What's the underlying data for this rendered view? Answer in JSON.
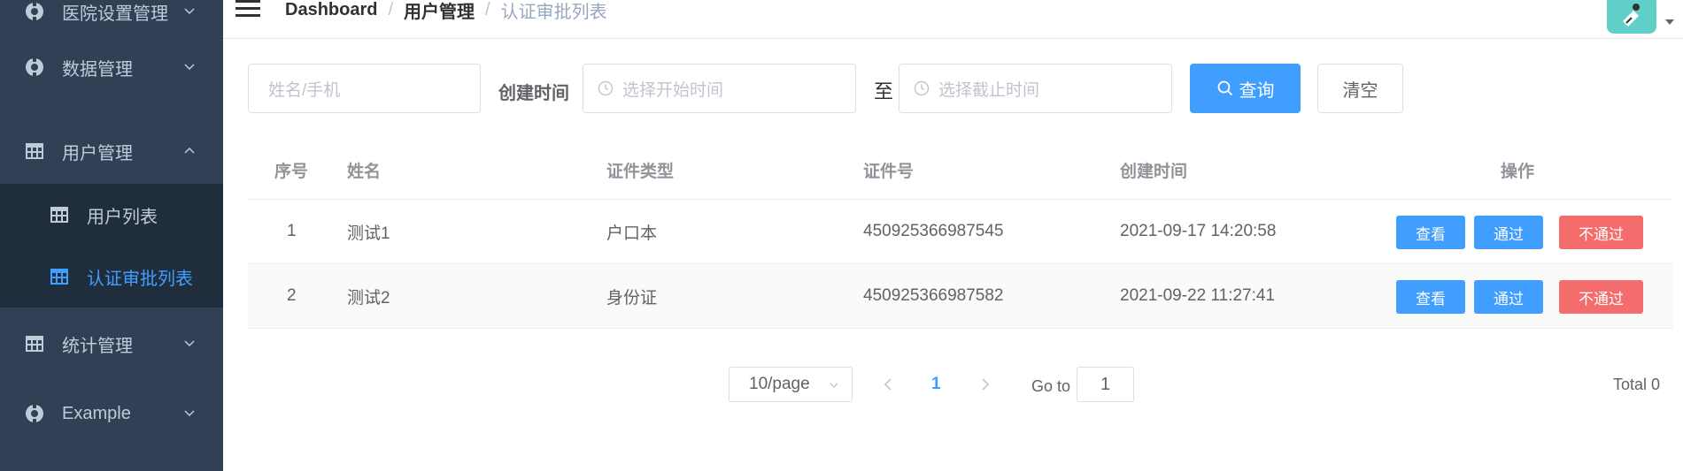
{
  "sidebar": {
    "items": [
      {
        "label": "医院设置管理",
        "icon": "gear-icon"
      },
      {
        "label": "数据管理",
        "icon": "gear-icon"
      },
      {
        "label": "用户管理",
        "icon": "table-icon",
        "expanded": true
      },
      {
        "label": "统计管理",
        "icon": "table-icon"
      },
      {
        "label": "Example",
        "icon": "gear-icon"
      }
    ],
    "subitems": [
      {
        "label": "用户列表",
        "icon": "table-icon"
      },
      {
        "label": "认证审批列表",
        "icon": "table-icon",
        "active": true
      }
    ],
    "colors": {
      "bg": "#304156",
      "sub_bg": "#1f2d3d",
      "text": "#bfcbd9",
      "active": "#409eff"
    }
  },
  "header": {
    "breadcrumb": [
      "Dashboard",
      "用户管理",
      "认证审批列表"
    ],
    "separator": "/"
  },
  "filters": {
    "keyword_placeholder": "姓名/手机",
    "created_label": "创建时间",
    "start_placeholder": "选择开始时间",
    "to_label": "至",
    "end_placeholder": "选择截止时间",
    "search_label": "查询",
    "clear_label": "清空"
  },
  "table": {
    "headers": [
      "序号",
      "姓名",
      "证件类型",
      "证件号",
      "创建时间",
      "操作"
    ],
    "rows": [
      {
        "index": "1",
        "name": "测试1",
        "cert_type": "户口本",
        "cert_no": "450925366987545",
        "created": "2021-09-17 14:20:58"
      },
      {
        "index": "2",
        "name": "测试2",
        "cert_type": "身份证",
        "cert_no": "450925366987582",
        "created": "2021-09-22 11:27:41"
      }
    ],
    "actions": {
      "view": "查看",
      "pass": "通过",
      "reject": "不通过"
    }
  },
  "pagination": {
    "page_size": "10/page",
    "current_page": "1",
    "goto_label": "Go to",
    "goto_value": "1",
    "total": "Total 0"
  },
  "colors": {
    "primary": "#409eff",
    "danger": "#f56c6c"
  }
}
